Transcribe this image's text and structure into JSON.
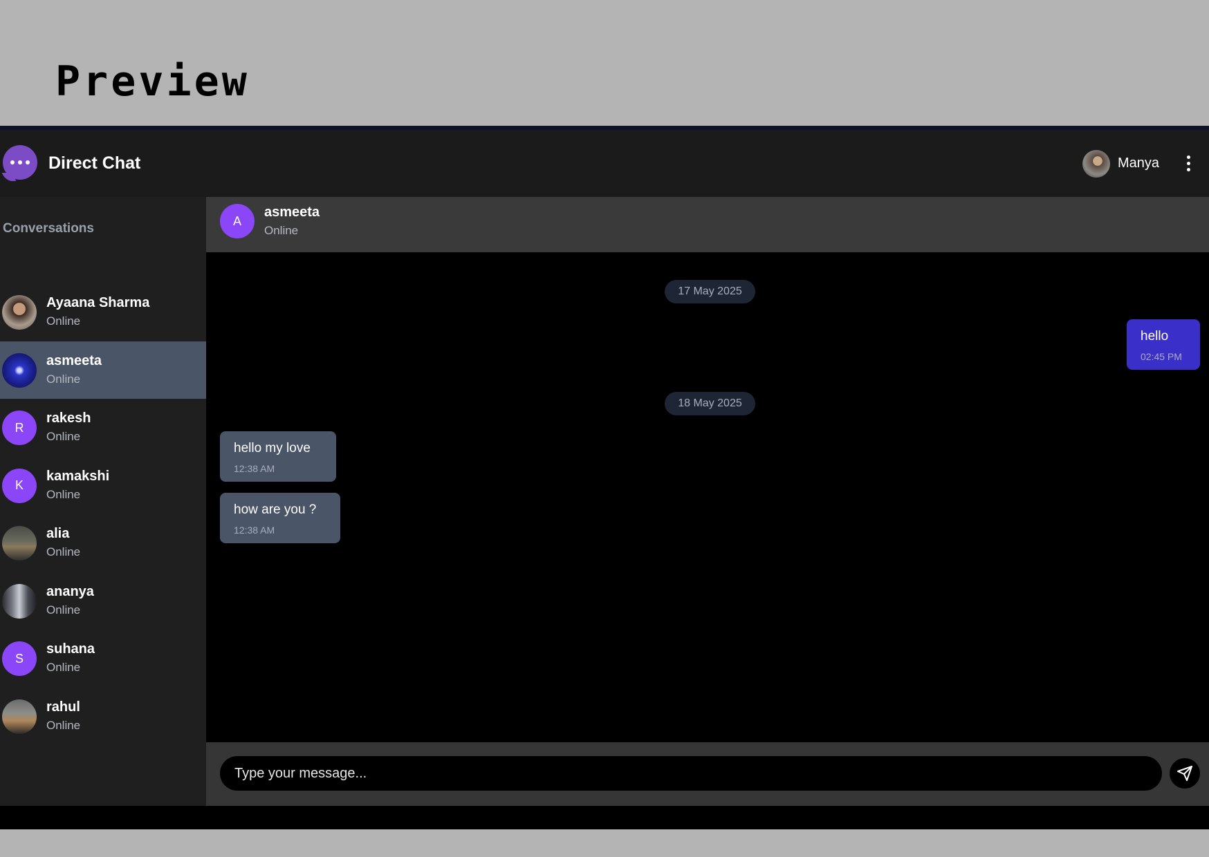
{
  "preview": {
    "title": "Preview"
  },
  "header": {
    "app_title": "Direct Chat",
    "user_name": "Manya",
    "logo_icon": "chat-bubble-icon",
    "menu_icon": "kebab-menu-icon"
  },
  "sidebar": {
    "heading": "Conversations",
    "conversations": [
      {
        "name": "Ayaana Sharma",
        "status": "Online",
        "avatar_type": "photo",
        "avatar_letter": ""
      },
      {
        "name": "asmeeta",
        "status": "Online",
        "avatar_type": "photo",
        "avatar_letter": "",
        "active": true
      },
      {
        "name": "rakesh",
        "status": "Online",
        "avatar_type": "letter",
        "avatar_letter": "R"
      },
      {
        "name": "kamakshi",
        "status": "Online",
        "avatar_type": "letter",
        "avatar_letter": "K"
      },
      {
        "name": "alia",
        "status": "Online",
        "avatar_type": "photo",
        "avatar_letter": ""
      },
      {
        "name": "ananya",
        "status": "Online",
        "avatar_type": "photo",
        "avatar_letter": ""
      },
      {
        "name": "suhana",
        "status": "Online",
        "avatar_type": "letter",
        "avatar_letter": "S"
      },
      {
        "name": "rahul",
        "status": "Online",
        "avatar_type": "photo",
        "avatar_letter": ""
      }
    ]
  },
  "chat": {
    "contact_name": "asmeeta",
    "contact_status": "Online",
    "contact_avatar_letter": "A",
    "groups": [
      {
        "date": "17 May 2025",
        "messages": [
          {
            "text": "hello",
            "time": "02:45 PM",
            "direction": "outgoing"
          }
        ]
      },
      {
        "date": "18 May 2025",
        "messages": [
          {
            "text": "hello my love",
            "time": "12:38 AM",
            "direction": "incoming"
          },
          {
            "text": "how are you ?",
            "time": "12:38 AM",
            "direction": "incoming"
          }
        ]
      }
    ]
  },
  "composer": {
    "placeholder": "Type your message...",
    "value": "",
    "send_icon": "send-icon"
  },
  "colors": {
    "accent_purple": "#8b46f7",
    "outgoing_bubble": "#3b2fc9",
    "incoming_bubble": "#4a5568",
    "active_row": "#4a5568"
  }
}
